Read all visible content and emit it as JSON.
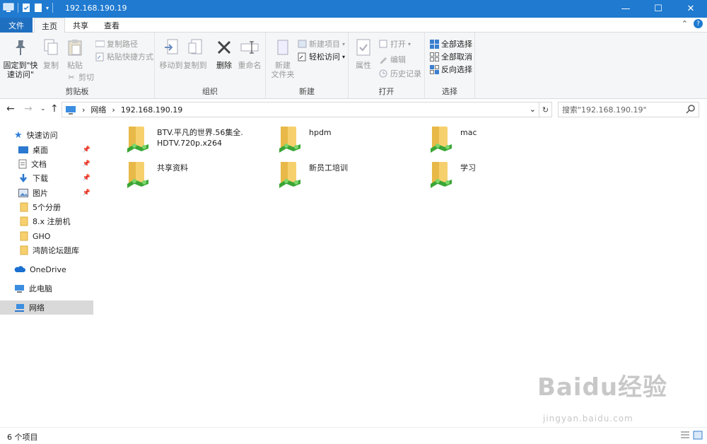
{
  "window": {
    "title": "192.168.190.19",
    "minimize": "—",
    "maximize": "☐",
    "close": "✕"
  },
  "tabs": {
    "file": "文件",
    "home": "主页",
    "share": "共享",
    "view": "查看"
  },
  "ribbon": {
    "clipboard": {
      "label": "剪贴板",
      "pin_quick": "固定到\"快\n速访问\"",
      "copy": "复制",
      "paste": "粘贴",
      "copy_path": "复制路径",
      "paste_shortcut": "粘贴快捷方式",
      "cut": "剪切"
    },
    "organize": {
      "label": "组织",
      "move_to": "移动到",
      "copy_to": "复制到",
      "delete": "删除",
      "rename": "重命名"
    },
    "new": {
      "label": "新建",
      "new_folder": "新建\n文件夹",
      "new_item": "新建项目",
      "easy_access": "轻松访问"
    },
    "open": {
      "label": "打开",
      "properties": "属性",
      "open": "打开",
      "edit": "编辑",
      "history": "历史记录"
    },
    "select": {
      "label": "选择",
      "select_all": "全部选择",
      "select_none": "全部取消",
      "invert": "反向选择"
    }
  },
  "address": {
    "breadcrumb": [
      "网络",
      "192.168.190.19"
    ],
    "search_placeholder": "搜索\"192.168.190.19\""
  },
  "sidebar": {
    "quick_access": "快速访问",
    "items": [
      {
        "label": "桌面",
        "pinned": true
      },
      {
        "label": "文档",
        "pinned": true
      },
      {
        "label": "下载",
        "pinned": true
      },
      {
        "label": "图片",
        "pinned": true
      },
      {
        "label": "5个分册",
        "pinned": false
      },
      {
        "label": "8.x 注册机",
        "pinned": false
      },
      {
        "label": "GHO",
        "pinned": false
      },
      {
        "label": "鸿鹄论坛题库",
        "pinned": false
      }
    ],
    "onedrive": "OneDrive",
    "this_pc": "此电脑",
    "network": "网络"
  },
  "folders": [
    {
      "name": "BTV.平凡的世界.56集全.\nHDTV.720p.x264"
    },
    {
      "name": "hpdm"
    },
    {
      "name": "mac"
    },
    {
      "name": "共享资料"
    },
    {
      "name": "新员工培训"
    },
    {
      "name": "学习"
    }
  ],
  "status": {
    "count": "6 个项目"
  },
  "watermark": {
    "main": "Baidu经验",
    "sub": "jingyan.baidu.com"
  }
}
